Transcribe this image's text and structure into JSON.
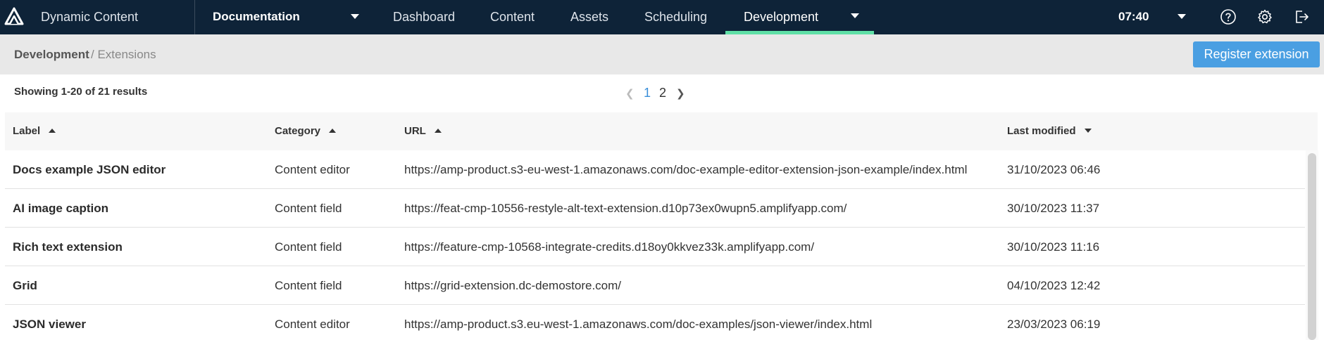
{
  "header": {
    "app_title": "Dynamic Content",
    "hub": "Documentation",
    "nav": [
      "Dashboard",
      "Content",
      "Assets",
      "Scheduling",
      "Development"
    ],
    "active_nav": "Development",
    "time": "07:40",
    "accent": "#5fdfa6",
    "icons": [
      "amplience-logo-icon",
      "help-icon",
      "gear-icon",
      "logout-icon"
    ]
  },
  "breadcrumb": {
    "root": "Development",
    "current": "/ Extensions"
  },
  "toolbar": {
    "register_label": "Register extension",
    "register_color": "#4a9fe2"
  },
  "results": {
    "summary": "Showing 1-20 of 21 results",
    "pages": [
      "1",
      "2"
    ],
    "current_page": "1"
  },
  "table": {
    "columns": [
      "Label",
      "Category",
      "URL",
      "Last modified"
    ],
    "rows": [
      {
        "label": "Docs example JSON editor",
        "category": "Content editor",
        "url": "https://amp-product.s3-eu-west-1.amazonaws.com/doc-example-editor-extension-json-example/index.html",
        "modified": "31/10/2023 06:46"
      },
      {
        "label": "AI image caption",
        "category": "Content field",
        "url": "https://feat-cmp-10556-restyle-alt-text-extension.d10p73ex0wupn5.amplifyapp.com/",
        "modified": "30/10/2023 11:37"
      },
      {
        "label": "Rich text extension",
        "category": "Content field",
        "url": "https://feature-cmp-10568-integrate-credits.d18oy0kkvez33k.amplifyapp.com/",
        "modified": "30/10/2023 11:16"
      },
      {
        "label": "Grid",
        "category": "Content field",
        "url": "https://grid-extension.dc-demostore.com/",
        "modified": "04/10/2023 12:42"
      },
      {
        "label": "JSON viewer",
        "category": "Content editor",
        "url": "https://amp-product.s3.eu-west-1.amazonaws.com/doc-examples/json-viewer/index.html",
        "modified": "23/03/2023 06:19"
      }
    ]
  }
}
